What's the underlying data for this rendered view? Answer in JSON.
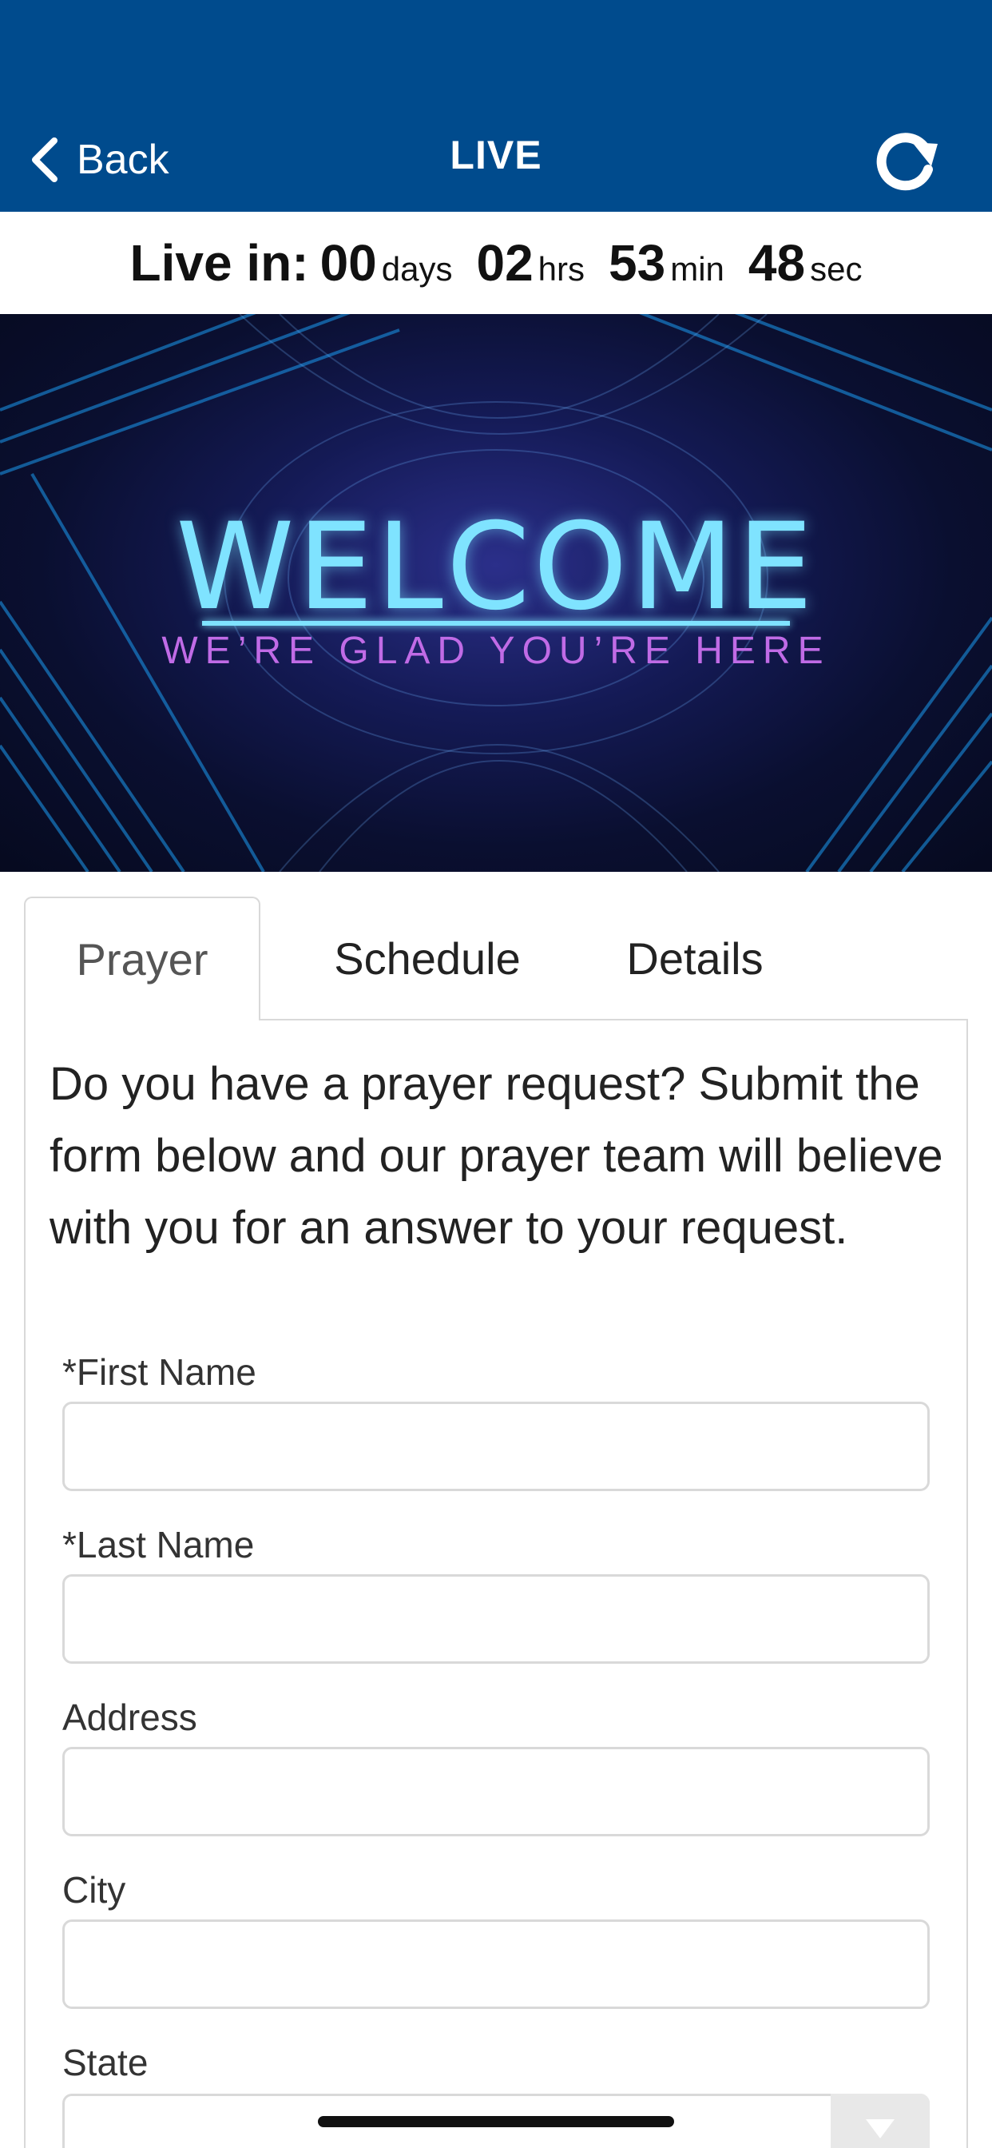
{
  "header": {
    "back_label": "Back",
    "title": "LIVE",
    "refresh_icon": "refresh-icon",
    "colors": {
      "bar": "#004b8d",
      "text": "#ffffff"
    }
  },
  "countdown": {
    "lead": "Live in:",
    "days_value": "00",
    "days_unit": "days",
    "hours_value": "02",
    "hours_unit": "hrs",
    "minutes_value": "53",
    "minutes_unit": "min",
    "seconds_value": "48",
    "seconds_unit": "sec"
  },
  "hero": {
    "title": "WELCOME",
    "subtitle": "WE’RE GLAD YOU’RE HERE",
    "colors": {
      "title": "#7fe3ff",
      "subtitle": "#c06be6"
    }
  },
  "tabs": [
    {
      "label": "Prayer",
      "active": true
    },
    {
      "label": "Schedule",
      "active": false
    },
    {
      "label": "Details",
      "active": false
    }
  ],
  "prayer": {
    "intro": "Do you have a prayer request? Submit the form below and our prayer team will believe with you for an answer to your request.",
    "fields": [
      {
        "label": "*First Name",
        "value": ""
      },
      {
        "label": "*Last Name",
        "value": ""
      },
      {
        "label": "Address",
        "value": ""
      },
      {
        "label": "City",
        "value": ""
      },
      {
        "label": "State",
        "value": "",
        "type": "select"
      }
    ]
  }
}
